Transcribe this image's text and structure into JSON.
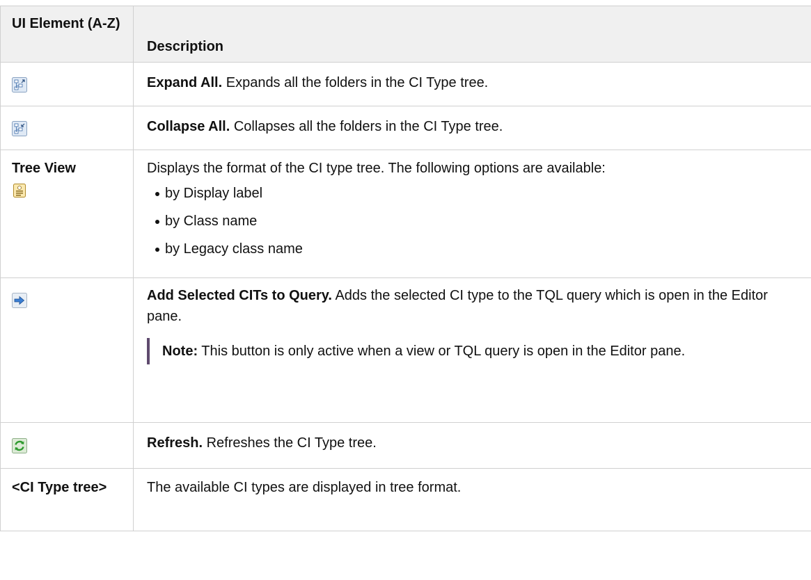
{
  "header": {
    "col1": "UI Element (A-Z)",
    "col2": "Description"
  },
  "rows": [
    {
      "icon": "expand-all-icon",
      "bold": "Expand All.",
      "text": " Expands all the folders in the CI Type tree."
    },
    {
      "icon": "collapse-all-icon",
      "bold": "Collapse All.",
      "text": " Collapses all the folders in the CI Type tree."
    },
    {
      "element": "Tree View",
      "icon": "tree-view-icon",
      "text": "Displays the format of the CI type tree. The following options are available:",
      "options": [
        "by Display label",
        "by Class name",
        "by Legacy class name"
      ]
    },
    {
      "icon": "add-arrow-icon",
      "bold": "Add Selected CITs to Query.",
      "text": " Adds the selected CI type to the TQL query which is open in the Editor pane.",
      "note_label": "Note:",
      "note_text": " This button is only active when a view or TQL query is open in the Editor pane."
    },
    {
      "icon": "refresh-icon",
      "bold": "Refresh.",
      "text": " Refreshes the CI Type tree."
    },
    {
      "element": "<CI Type tree>",
      "text": "The available CI types are displayed in tree format."
    }
  ],
  "colors": {
    "header_bg": "#f0f0f0",
    "border": "#d0d0d0",
    "note_bar": "#5f4a6e"
  }
}
